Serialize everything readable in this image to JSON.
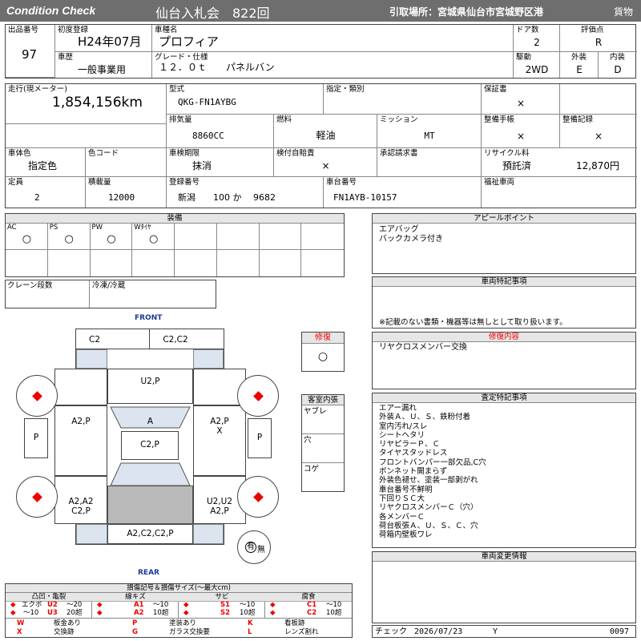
{
  "header": {
    "condition_check": "Condition Check",
    "auction": "仙台入札会　822回",
    "pickup": "引取場所：宮城県仙台市宮城野区港",
    "category": "貨物"
  },
  "row1": {
    "lot_label": "出品番号",
    "lot": "97",
    "first_reg_label": "初度登録",
    "first_reg": "H24年07月",
    "model_name_label": "車種名",
    "model_name": "プロフィア",
    "doors_label": "ドア数",
    "doors": "2",
    "grade_score_label": "評価点",
    "grade_score": "R",
    "history_label": "車歴",
    "history": "一般事業用",
    "grade_label": "グレード・仕様",
    "grade": "１２．０ｔ　　パネルバン",
    "drive_label": "駆動",
    "drive": "2WD",
    "ext_label": "外装",
    "ext": "E",
    "int_label": "内装",
    "int": "D"
  },
  "row2": {
    "mileage_label": "走行(現メーター)",
    "mileage": "1,854,156km",
    "type_label": "型式",
    "type": "QKG-FN1AYBG",
    "designation_label": "指定・類別",
    "warranty_label": "保証書",
    "warranty": "×",
    "displacement_label": "排気量",
    "displacement": "8860CC",
    "fuel_label": "燃料",
    "fuel": "軽油",
    "mission_label": "ミッション",
    "mission": "MT",
    "manual_label": "整備手帳",
    "manual": "×",
    "record_label": "整備記録",
    "record": "×",
    "color_label": "車体色",
    "color": "指定色",
    "colorcode_label": "色コード",
    "inspection_label": "車検期限",
    "inspection": "抹消",
    "ins_doc_label": "検付自賠責",
    "ins_doc": "×",
    "approval_label": "承認請求書",
    "recycle_label": "リサイクル料",
    "recycle_status": "預託済",
    "recycle_fee": "12,870円",
    "capacity_label": "定員",
    "capacity": "2",
    "load_label": "積載量",
    "load": "12000",
    "reg_no_label": "登録番号",
    "reg_no": "新潟　　100 か　 9682",
    "chassis_label": "車台番号",
    "chassis": "FN1AYB-10157",
    "welfare_label": "福祉車両"
  },
  "equipment": {
    "title": "装備",
    "items": [
      {
        "label": "AC",
        "mark": "○"
      },
      {
        "label": "PS",
        "mark": "○"
      },
      {
        "label": "PW",
        "mark": "○"
      },
      {
        "label": "Wﾀｲﾔ",
        "mark": "○"
      }
    ],
    "crane_label": "クレーン段数",
    "fridge_label": "冷凍/冷蔵"
  },
  "appeal": {
    "title": "アピールポイント",
    "lines": [
      "エアバッグ",
      "バックカメラ付き"
    ]
  },
  "special": {
    "title": "車両特記事項",
    "note": "※記載のない書類・機器等は無しとして取り扱います。"
  },
  "repair": {
    "label": "修復",
    "mark": "○",
    "content_title": "修復内容",
    "content": "リヤクロスメンバー交換"
  },
  "cabin": {
    "title": "客室内張",
    "items": [
      "ヤブレ",
      "穴",
      "コゲ"
    ]
  },
  "inspector": {
    "title": "査定特記事項",
    "lines": [
      "エアー漏れ",
      "外装Ａ、Ｕ、Ｓ、鉄粉付着",
      "室内汚れ/スレ",
      "シートヘタリ",
      "リヤピラーＰ、Ｃ",
      "タイヤスタッドレス",
      "フロントバンパー一部欠品,C穴",
      "ボンネット開まらず",
      "外装色褪せ、塗装一部剥がれ",
      "車台番号不鮮明",
      "下回りＳＣ大",
      "リヤクロスメンバーＣ（穴）",
      "各メンバーＣ",
      "荷台板張Ａ、Ｕ、Ｓ、Ｃ、穴",
      "荷箱内壁板ワレ"
    ]
  },
  "change": {
    "title": "車両変更情報"
  },
  "diagram": {
    "front": "FRONT",
    "rear": "REAR",
    "labels": {
      "front_left": "C2",
      "front_right": "C2,C2",
      "hood": "U2,P",
      "left_front_door": "A2,P",
      "windshield": "A",
      "right_front_door": "A2,P\nX",
      "left_side": "P",
      "roof": "C2,P",
      "right_side": "P",
      "left_rear": "A2,A2\nC2,P",
      "right_rear": "U2,U2\nA2,P",
      "rear_bumper": "A2,C2,C2,P",
      "spare": "有",
      "spare_none": "無"
    }
  },
  "legend": {
    "title": "損傷記号＆損傷サイズ(～最大cm)",
    "groups": [
      {
        "name": "凸凹・亀裂",
        "a": "エクボ",
        "b": "U2",
        "c": "～20",
        "d": "～10",
        "e": "U3",
        "f": "20超"
      },
      {
        "name": "線キズ",
        "b": "A1",
        "c": "～10",
        "e": "A2",
        "f": "10超"
      },
      {
        "name": "サビ",
        "b": "S1",
        "c": "～10",
        "e": "S2",
        "f": "10超"
      },
      {
        "name": "腐食",
        "b": "C1",
        "c": "～10",
        "e": "C2",
        "f": "10超"
      }
    ],
    "codes": [
      {
        "k": "W",
        "v": "板金あり"
      },
      {
        "k": "P",
        "v": "塗装あり"
      },
      {
        "k": "K",
        "v": "看板跡"
      },
      {
        "k": "X",
        "v": "交換跡"
      },
      {
        "k": "G",
        "v": "ガラス交換要"
      },
      {
        "k": "L",
        "v": "レンズ割れ"
      }
    ]
  },
  "footer": {
    "check_label": "チェック",
    "date": "2026/07/23",
    "mark": "Y",
    "number": "0097"
  }
}
